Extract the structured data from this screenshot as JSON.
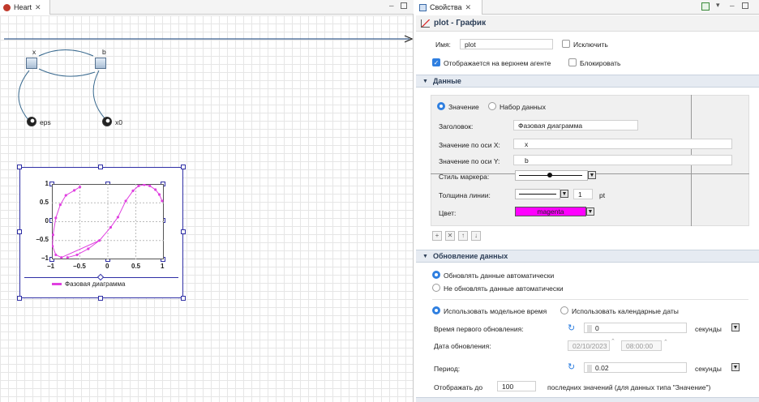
{
  "left_tab": {
    "title": "Heart"
  },
  "diagram": {
    "nodes": {
      "x": "x",
      "b": "b",
      "eps": "eps",
      "x0": "x0"
    },
    "plot": {
      "y_ticks": [
        "1",
        "0.5",
        "0",
        "−0.5",
        "−1"
      ],
      "x_ticks": [
        "−1",
        "−0.5",
        "0",
        "0.5",
        "1"
      ],
      "legend": "Фазовая диаграмма",
      "series_color": "#e040e0",
      "points": [
        [
          -0.83,
          -0.95
        ],
        [
          -0.93,
          -0.88
        ],
        [
          -0.99,
          -0.65
        ],
        [
          -0.98,
          -0.35
        ],
        [
          -0.93,
          0.1
        ],
        [
          -0.85,
          0.45
        ],
        [
          -0.75,
          0.7
        ],
        [
          -0.6,
          0.83
        ],
        [
          -0.5,
          0.92
        ],
        [
          -0.15,
          -0.5
        ],
        [
          -0.35,
          -0.72
        ],
        [
          -0.55,
          -0.88
        ],
        [
          -0.72,
          -0.95
        ],
        [
          0.05,
          -0.15
        ],
        [
          0.18,
          0.12
        ],
        [
          0.32,
          0.55
        ],
        [
          0.45,
          0.82
        ],
        [
          0.55,
          0.95
        ],
        [
          0.65,
          0.98
        ],
        [
          0.75,
          0.95
        ],
        [
          0.85,
          0.85
        ],
        [
          0.92,
          0.72
        ],
        [
          0.97,
          0.55
        ]
      ]
    }
  },
  "right_tab": {
    "title": "Свойства"
  },
  "header": {
    "title": "plot - График"
  },
  "name_label": "Имя:",
  "name_value": "plot",
  "exclude_label": "Исключить",
  "shown_top_label": "Отображается на верхнем агенте",
  "lock_label": "Блокировать",
  "data_section": {
    "title": "Данные",
    "radio_value": "Значение",
    "radio_dataset": "Набор данных",
    "header_label": "Заголовок:",
    "header_value": "Фазовая диаграмма",
    "x_label": "Значение по оси X:",
    "x_value": "x",
    "y_label": "Значение по оси Y:",
    "y_value": "b",
    "marker_label": "Стиль маркера:",
    "width_label": "Толщина линии:",
    "width_value": "1",
    "width_unit": "pt",
    "color_label": "Цвет:",
    "color_value": "magenta",
    "color_hex": "#ff00ff"
  },
  "update_section": {
    "title": "Обновление данных",
    "auto_label": "Обновлять данные автоматически",
    "noauto_label": "Не обновлять данные автоматически",
    "model_time_label": "Использовать модельное время",
    "calendar_label": "Использовать календарные даты",
    "first_update_label": "Время первого обновления:",
    "first_update_value": "0",
    "first_update_unit": "секунды",
    "date_label": "Дата обновления:",
    "date_value": "02/10/2023",
    "time_value": "08:00:00",
    "period_label": "Период:",
    "period_value": "0.02",
    "period_unit": "секунды",
    "show_label": "Отображать до",
    "show_value": "100",
    "show_suffix": "последних значений (для данных типа \"Значение\")"
  },
  "colors": {
    "accent": "#2f7fe0",
    "magenta": "#ff00ff",
    "line_blue": "#3a5f8f"
  }
}
